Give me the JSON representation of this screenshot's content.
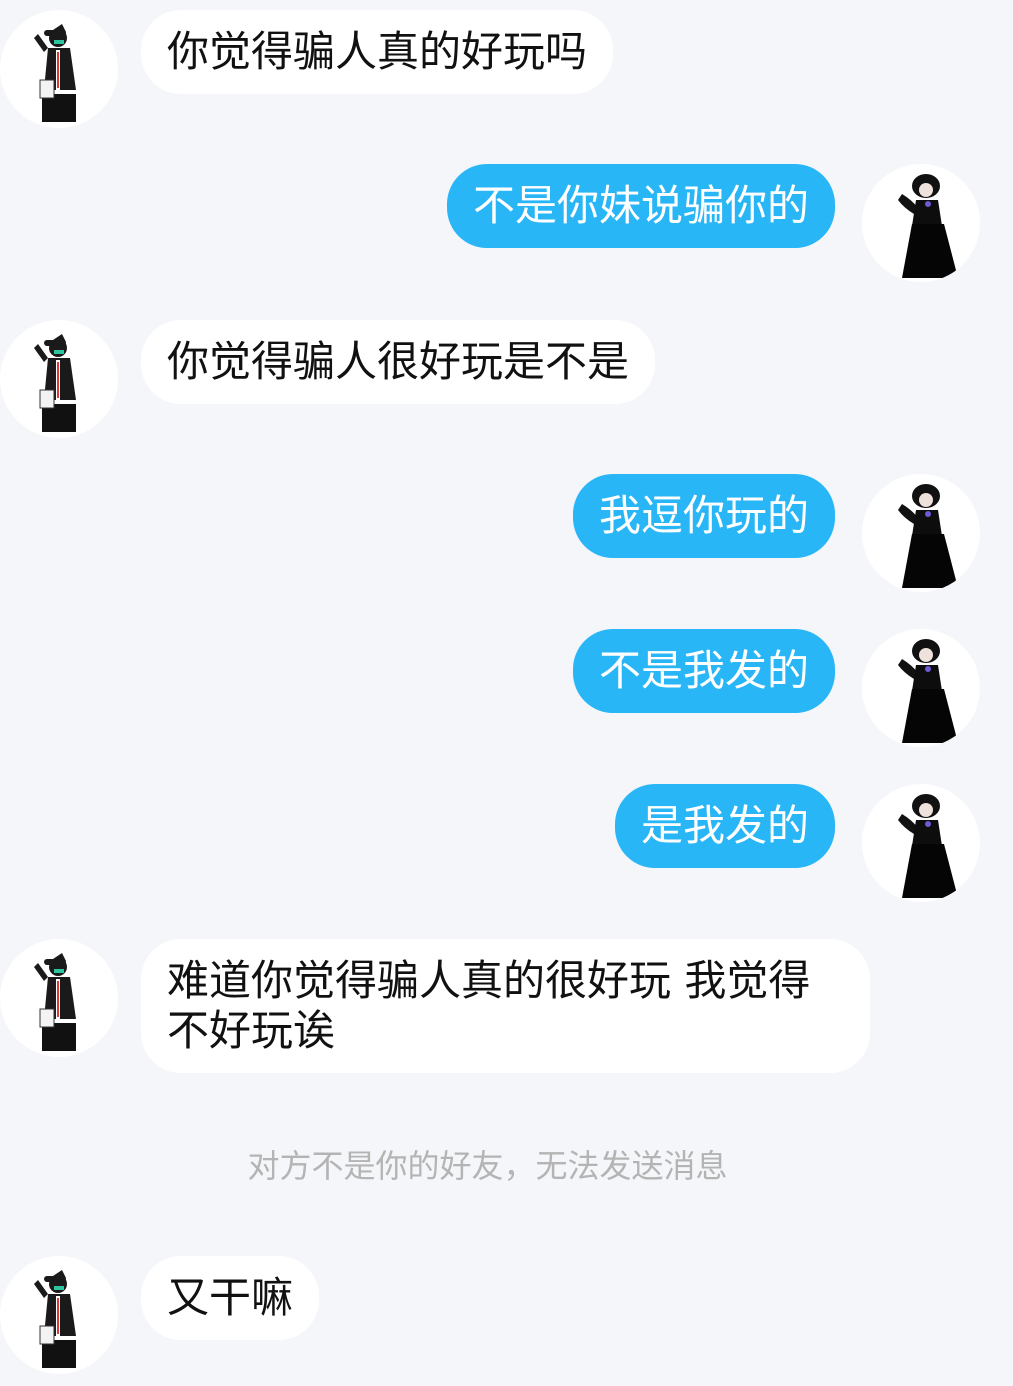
{
  "messages": [
    {
      "side": "in",
      "avatar": "hat-girl-avatar",
      "text": "你觉得骗人真的好玩吗"
    },
    {
      "side": "out",
      "avatar": "black-dress-avatar",
      "text": "不是你妹说骗你的"
    },
    {
      "side": "in",
      "avatar": "hat-girl-avatar",
      "text": "你觉得骗人很好玩是不是"
    },
    {
      "side": "out",
      "avatar": "black-dress-avatar",
      "text": "我逗你玩的"
    },
    {
      "side": "out",
      "avatar": "black-dress-avatar",
      "text": "不是我发的"
    },
    {
      "side": "out",
      "avatar": "black-dress-avatar",
      "text": "是我发的"
    },
    {
      "side": "in",
      "avatar": "hat-girl-avatar",
      "text": "难道你觉得骗人真的很好玩 我觉得不好玩诶"
    },
    {
      "side": "in",
      "avatar": "hat-girl-avatar",
      "text": "又干嘛"
    }
  ],
  "system_notice": "对方不是你的好友，无法发送消息",
  "colors": {
    "background": "#f5f6fa",
    "incoming_bubble": "#ffffff",
    "outgoing_bubble": "#29b6f6",
    "notice_text": "#b4b4b4"
  }
}
